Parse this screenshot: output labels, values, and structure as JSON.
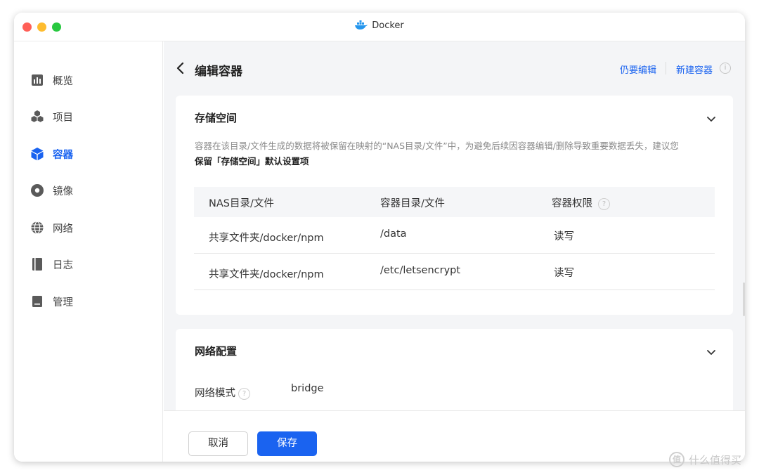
{
  "window": {
    "title": "Docker"
  },
  "sidebar": {
    "items": [
      {
        "label": "概览",
        "icon": "overview-icon"
      },
      {
        "label": "项目",
        "icon": "project-icon"
      },
      {
        "label": "容器",
        "icon": "container-icon",
        "active": true
      },
      {
        "label": "镜像",
        "icon": "image-icon"
      },
      {
        "label": "网络",
        "icon": "network-icon"
      },
      {
        "label": "日志",
        "icon": "log-icon"
      },
      {
        "label": "管理",
        "icon": "manage-icon"
      }
    ]
  },
  "header": {
    "title": "编辑容器",
    "link_keep_editing": "仍要编辑",
    "link_new_container": "新建容器"
  },
  "storage": {
    "title": "存储空间",
    "description": "容器在该目录/文件生成的数据将被保留在映射的“NAS目录/文件”中，为避免后续因容器编辑/删除导致重要数据丢失，建议您",
    "description_bold": "保留「存储空间」默认设置项",
    "columns": [
      "NAS目录/文件",
      "容器目录/文件",
      "容器权限"
    ],
    "rows": [
      {
        "nas": "共享文件夹/docker/npm",
        "container": "/data",
        "permission": "读写"
      },
      {
        "nas": "共享文件夹/docker/npm",
        "container": "/etc/letsencrypt",
        "permission": "读写"
      }
    ]
  },
  "network": {
    "title": "网络配置",
    "mode_label": "网络模式",
    "mode_value": "bridge"
  },
  "footer": {
    "cancel_label": "取消",
    "save_label": "保存"
  },
  "colors": {
    "accent": "#1a63f0",
    "traffic_red": "#ff5f57",
    "traffic_yellow": "#febc2e",
    "traffic_green": "#28c840"
  },
  "watermark": {
    "text": "什么值得买",
    "icon": "smzdm-logo-icon",
    "icon_glyph": "值"
  }
}
